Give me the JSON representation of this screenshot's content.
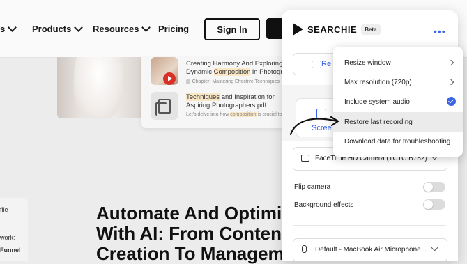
{
  "nav": {
    "items": [
      "s",
      "Products",
      "Resources",
      "Pricing"
    ],
    "login_label": "Sign In"
  },
  "results": [
    {
      "title_pre": "Creating Harmony And Exploring",
      "title_mid": "Dynamic ",
      "title_hl": "Composition",
      "title_post": " in Photogr",
      "sub": "Chapter: Mastering Effective Techniques"
    },
    {
      "title_hl": "Techniques",
      "title_post": " and Inspiration for",
      "title_line2": "Aspiring Photographers.pdf",
      "sub_pre": "Let's delve into how ",
      "sub_hl": "composition",
      "sub_post": " is crucial to e"
    }
  ],
  "headline": {
    "line1": "Automate And Optimiz",
    "line2": "With AI: From Content",
    "line3": "Creation To Manageme"
  },
  "side": {
    "line1": "file",
    "line2": "work:",
    "line3": "Funnel"
  },
  "panel": {
    "brand": "SEARCHIE",
    "badge": "Beta",
    "more": "•••",
    "record_tab": "Re",
    "screen_tab": "Scree",
    "camera_value": "FaceTime HD Camera (1C1C:B782)",
    "flip_camera": "Flip camera",
    "background_effects": "Background effects",
    "mic_value": "Default - MacBook Air Microphone..."
  },
  "menu": {
    "items": [
      {
        "label": "Resize window"
      },
      {
        "label": "Max resolution (720p)"
      },
      {
        "label": "Include system audio"
      },
      {
        "label": "Restore last recording"
      },
      {
        "label": "Download data for troubleshooting"
      }
    ]
  },
  "colors": {
    "accent": "#3a66e5",
    "highlight": "#fae7c5"
  }
}
